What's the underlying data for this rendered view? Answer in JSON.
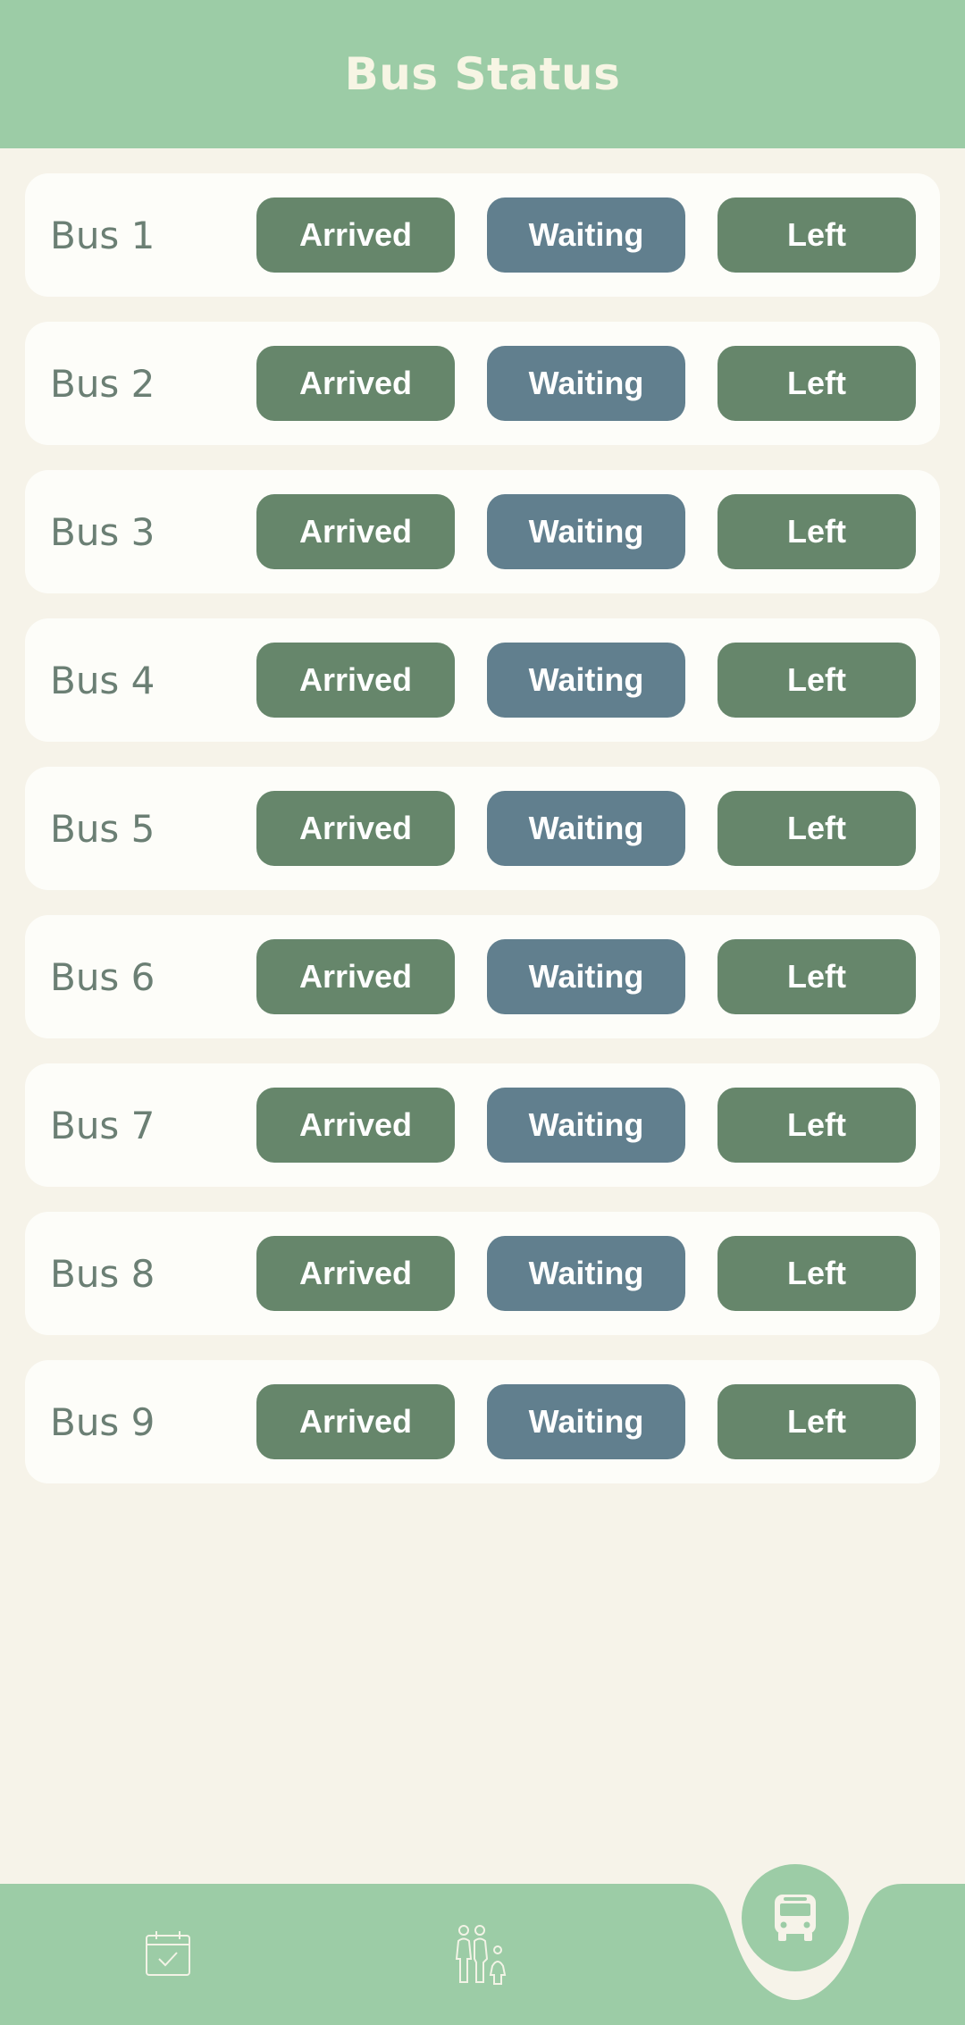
{
  "header": {
    "title": "Bus Status"
  },
  "buses": [
    {
      "name": "Bus 1",
      "arrived": "Arrived",
      "waiting": "Waiting",
      "left": "Left"
    },
    {
      "name": "Bus 2",
      "arrived": "Arrived",
      "waiting": "Waiting",
      "left": "Left"
    },
    {
      "name": "Bus 3",
      "arrived": "Arrived",
      "waiting": "Waiting",
      "left": "Left"
    },
    {
      "name": "Bus 4",
      "arrived": "Arrived",
      "waiting": "Waiting",
      "left": "Left"
    },
    {
      "name": "Bus 5",
      "arrived": "Arrived",
      "waiting": "Waiting",
      "left": "Left"
    },
    {
      "name": "Bus 6",
      "arrived": "Arrived",
      "waiting": "Waiting",
      "left": "Left"
    },
    {
      "name": "Bus 7",
      "arrived": "Arrived",
      "waiting": "Waiting",
      "left": "Left"
    },
    {
      "name": "Bus 8",
      "arrived": "Arrived",
      "waiting": "Waiting",
      "left": "Left"
    },
    {
      "name": "Bus 9",
      "arrived": "Arrived",
      "waiting": "Waiting",
      "left": "Left"
    }
  ],
  "nav": {
    "items": [
      {
        "icon": "calendar-check-icon"
      },
      {
        "icon": "family-icon"
      },
      {
        "icon": "bus-icon",
        "active": true
      }
    ]
  },
  "colors": {
    "header_bg": "#9ccca6",
    "page_bg": "#f6f3e9",
    "arrived": "#66866b",
    "waiting": "#617f8e",
    "left": "#66866b",
    "title_text": "#f7f5e4"
  }
}
